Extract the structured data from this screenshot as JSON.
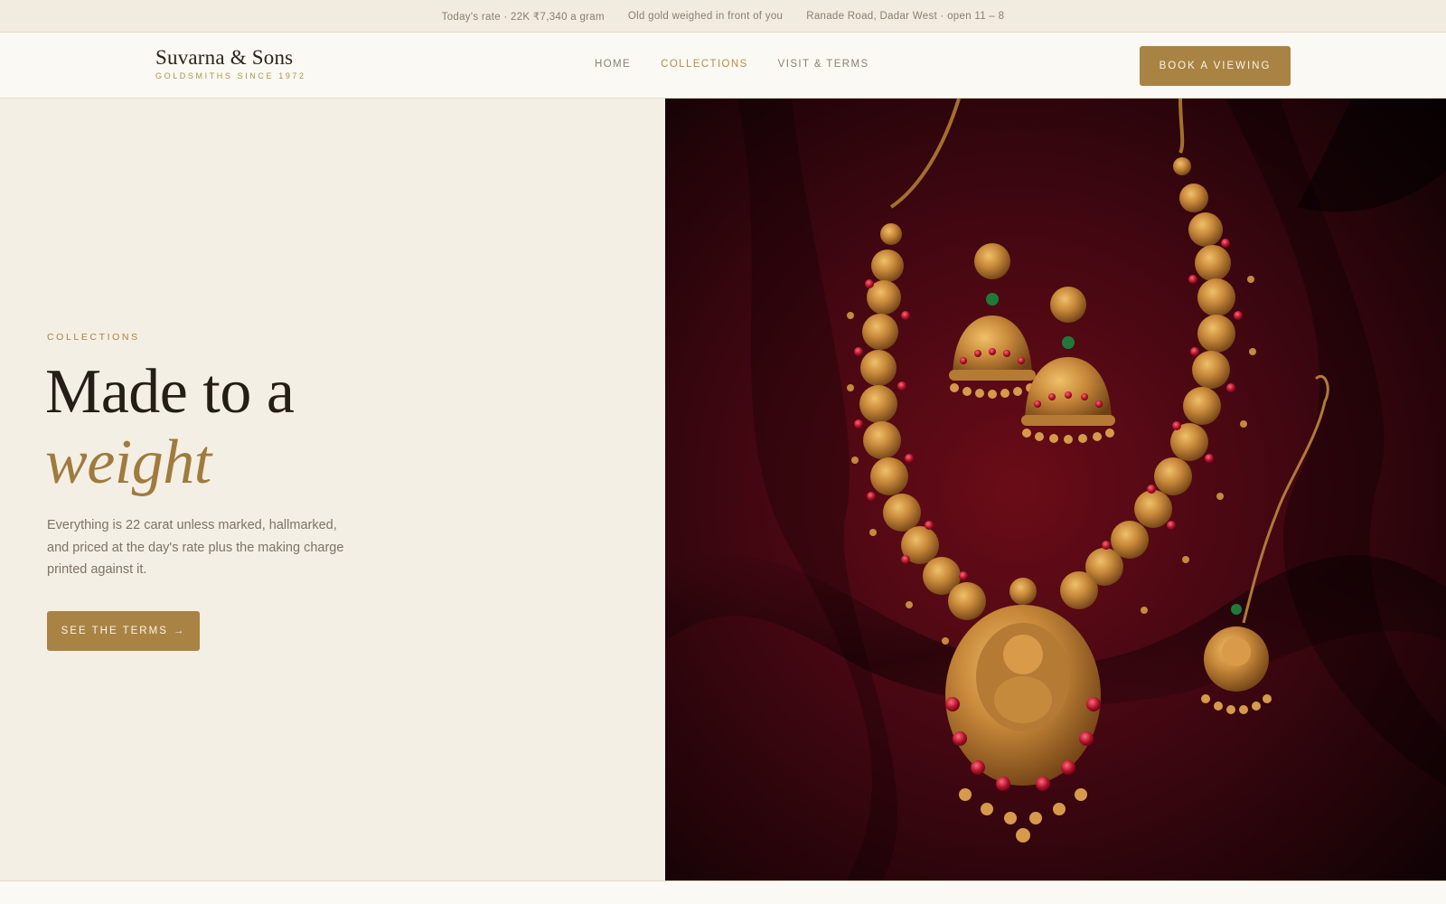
{
  "topbar": {
    "rate": "Today's rate · 22K ₹7,340 a gram",
    "weighing": "Old gold weighed in front of you",
    "address": "Ranade Road, Dadar West · open 11 – 8"
  },
  "header": {
    "logo_name": "Suvarna & Sons",
    "logo_tagline": "GOLDSMITHS SINCE 1972",
    "nav": [
      {
        "label": "HOME",
        "active": false
      },
      {
        "label": "COLLECTIONS",
        "active": true
      },
      {
        "label": "VISIT & TERMS",
        "active": false
      }
    ],
    "cta_label": "BOOK A VIEWING"
  },
  "hero": {
    "eyebrow": "COLLECTIONS",
    "headline_line1": "Made to a",
    "headline_line2": "weight",
    "blurb": "Everything is 22 carat unless marked, hallmarked, and priced at the day's rate plus the making charge printed against it.",
    "cta_label": "SEE THE TERMS",
    "cta_arrow": "→",
    "image_subject": "gold temple necklace with jhumka earrings and maang tikka on red velvet"
  },
  "icons": {
    "cta_arrow": "arrow-right-icon"
  },
  "colors": {
    "accent": "#a98343",
    "background": "#f4efe4",
    "header_bg": "#fbf9f3",
    "text_dark": "#241e16",
    "velvet": "#5a0a14"
  }
}
